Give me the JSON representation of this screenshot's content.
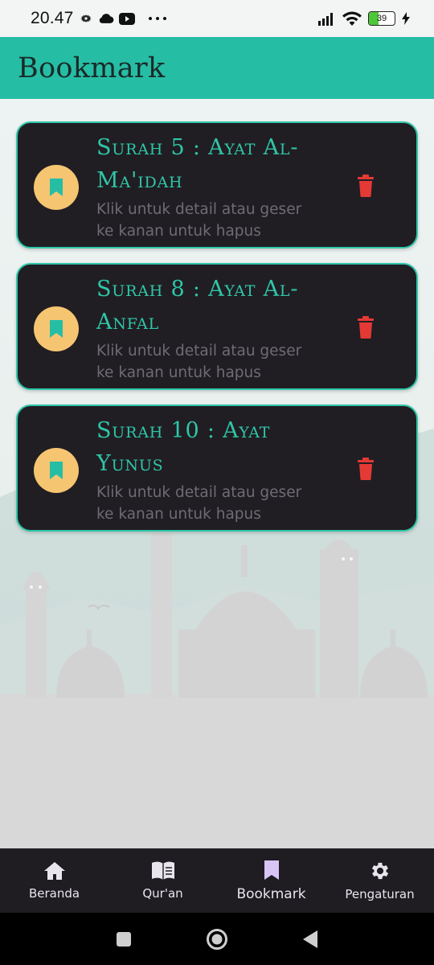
{
  "status_bar": {
    "time": "20.47",
    "battery_level": "39",
    "icons": [
      "gear-icon",
      "cloud-icon",
      "youtube-icon",
      "more-dots-icon",
      "signal-icon",
      "wifi-icon",
      "battery-icon",
      "charging-icon"
    ]
  },
  "app_bar": {
    "title": "Bookmark"
  },
  "bookmarks": [
    {
      "title": "Surah 5 : Ayat Al-Ma'idah",
      "subtitle": "Klik untuk detail atau geser ke kanan untuk hapus"
    },
    {
      "title": "Surah 8 : Ayat Al-Anfal",
      "subtitle": "Klik untuk detail atau geser ke kanan untuk hapus"
    },
    {
      "title": "Surah 10 : Ayat Yunus",
      "subtitle": "Klik untuk detail atau geser ke kanan untuk hapus"
    }
  ],
  "bottom_nav": {
    "items": [
      {
        "label": "Beranda",
        "icon": "home-icon"
      },
      {
        "label": "Qur'an",
        "icon": "book-icon"
      },
      {
        "label": "Bookmark",
        "icon": "bookmark-icon",
        "active": true
      },
      {
        "label": "Pengaturan",
        "icon": "gear-icon"
      }
    ]
  },
  "colors": {
    "accent": "#26bda5",
    "card_bg": "#201e23",
    "title_teal": "#2fc6a8",
    "avatar_bg": "#f6c571",
    "delete_red": "#e53935",
    "nav_bg": "#1f1c22",
    "active_nav_icon": "#d9c5f5"
  }
}
